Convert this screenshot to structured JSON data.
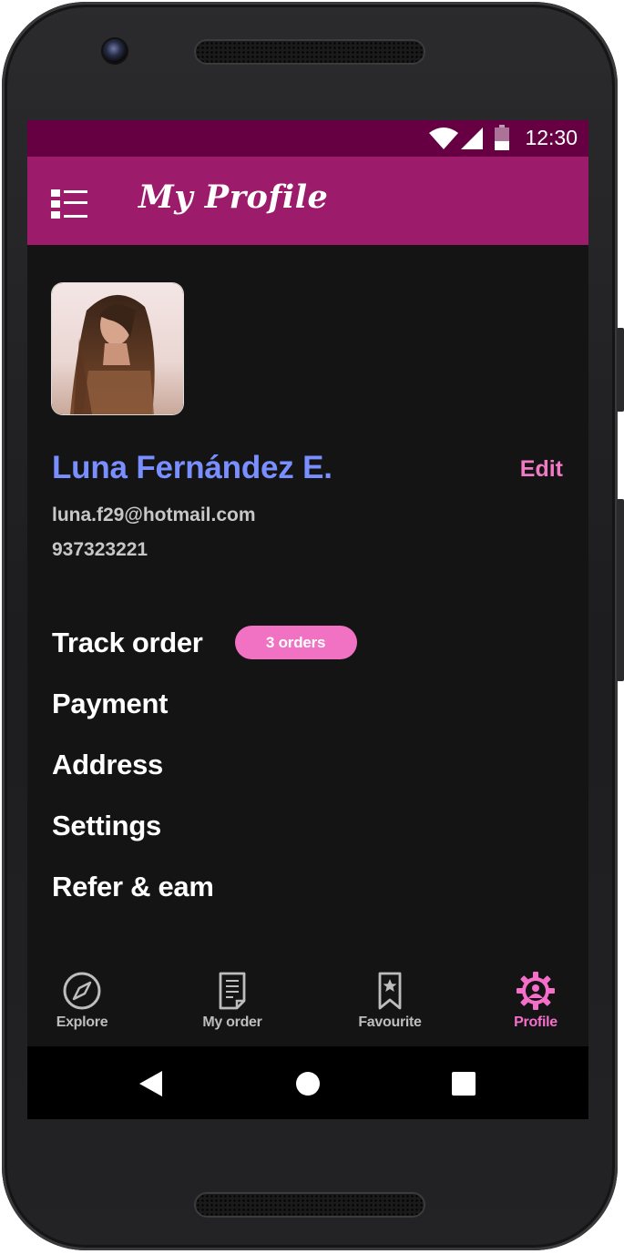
{
  "status_bar": {
    "time": "12:30"
  },
  "app_bar": {
    "title": "My Profile",
    "menu_icon": "menu-list-icon"
  },
  "profile": {
    "name": "Luna Fernández E.",
    "email": "luna.f29@hotmail.com",
    "phone": "937323221",
    "edit_label": "Edit"
  },
  "menu": {
    "track_order": "Track order",
    "track_order_badge": "3 orders",
    "payment": "Payment",
    "address": "Address",
    "settings": "Settings",
    "refer": "Refer & eam"
  },
  "bottom_nav": {
    "items": [
      {
        "label": "Explore",
        "icon": "compass-icon"
      },
      {
        "label": "My order",
        "icon": "receipt-icon"
      },
      {
        "label": "Favourite",
        "icon": "bookmark-star-icon"
      },
      {
        "label": "Profile",
        "icon": "gear-user-icon"
      }
    ],
    "active_index": 3
  },
  "colors": {
    "status_bar": "#660043",
    "app_bar": "#9c1b6b",
    "background": "#141414",
    "name": "#7a8fff",
    "accent": "#f171c3"
  }
}
